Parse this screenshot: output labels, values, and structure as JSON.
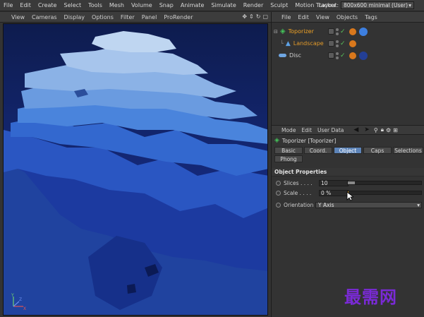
{
  "menubar": {
    "items": [
      "File",
      "Edit",
      "Create",
      "Select",
      "Tools",
      "Mesh",
      "Volume",
      "Snap",
      "Animate",
      "Simulate",
      "Render",
      "Sculpt",
      "Motion Tracker"
    ],
    "layout_label": "Layout:",
    "layout_value": "800x600 minimal (User)"
  },
  "viewport": {
    "menu": [
      "View",
      "Cameras",
      "Display",
      "Options",
      "Filter",
      "Panel",
      "ProRender"
    ],
    "nav_icons": [
      "move-icon",
      "zoom-icon",
      "rotate-icon",
      "maximize-icon"
    ],
    "axis": {
      "x": "X",
      "y": "Y",
      "z": "Z"
    },
    "colors": {
      "background": "#13245e",
      "top_layer": "#b3cfee",
      "deep_layer": "#1b3a9a"
    }
  },
  "object_manager": {
    "menu": [
      "File",
      "Edit",
      "View",
      "Objects",
      "Tags"
    ],
    "objects": [
      {
        "name": "Toporizer",
        "color": "#f0a325"
      },
      {
        "name": "Landscape",
        "color": "#e29a2a"
      },
      {
        "name": "Disc",
        "color": "#cfcfcf"
      }
    ]
  },
  "attributes": {
    "menu": [
      "Mode",
      "Edit",
      "User Data"
    ],
    "title": "Toporizer [Toporizer]",
    "tabs": [
      "Basic",
      "Coord.",
      "Object",
      "Caps",
      "Selections",
      "Phong"
    ],
    "active_tab": "Object",
    "section": "Object Properties",
    "props": {
      "slices_label": "Slices . . . .",
      "slices_value": "10",
      "scale_label": "Scale . . . .",
      "scale_value": "0 %",
      "orientation_label": "Orientation",
      "orientation_value": "Y Axis"
    }
  },
  "watermark": "最需网"
}
